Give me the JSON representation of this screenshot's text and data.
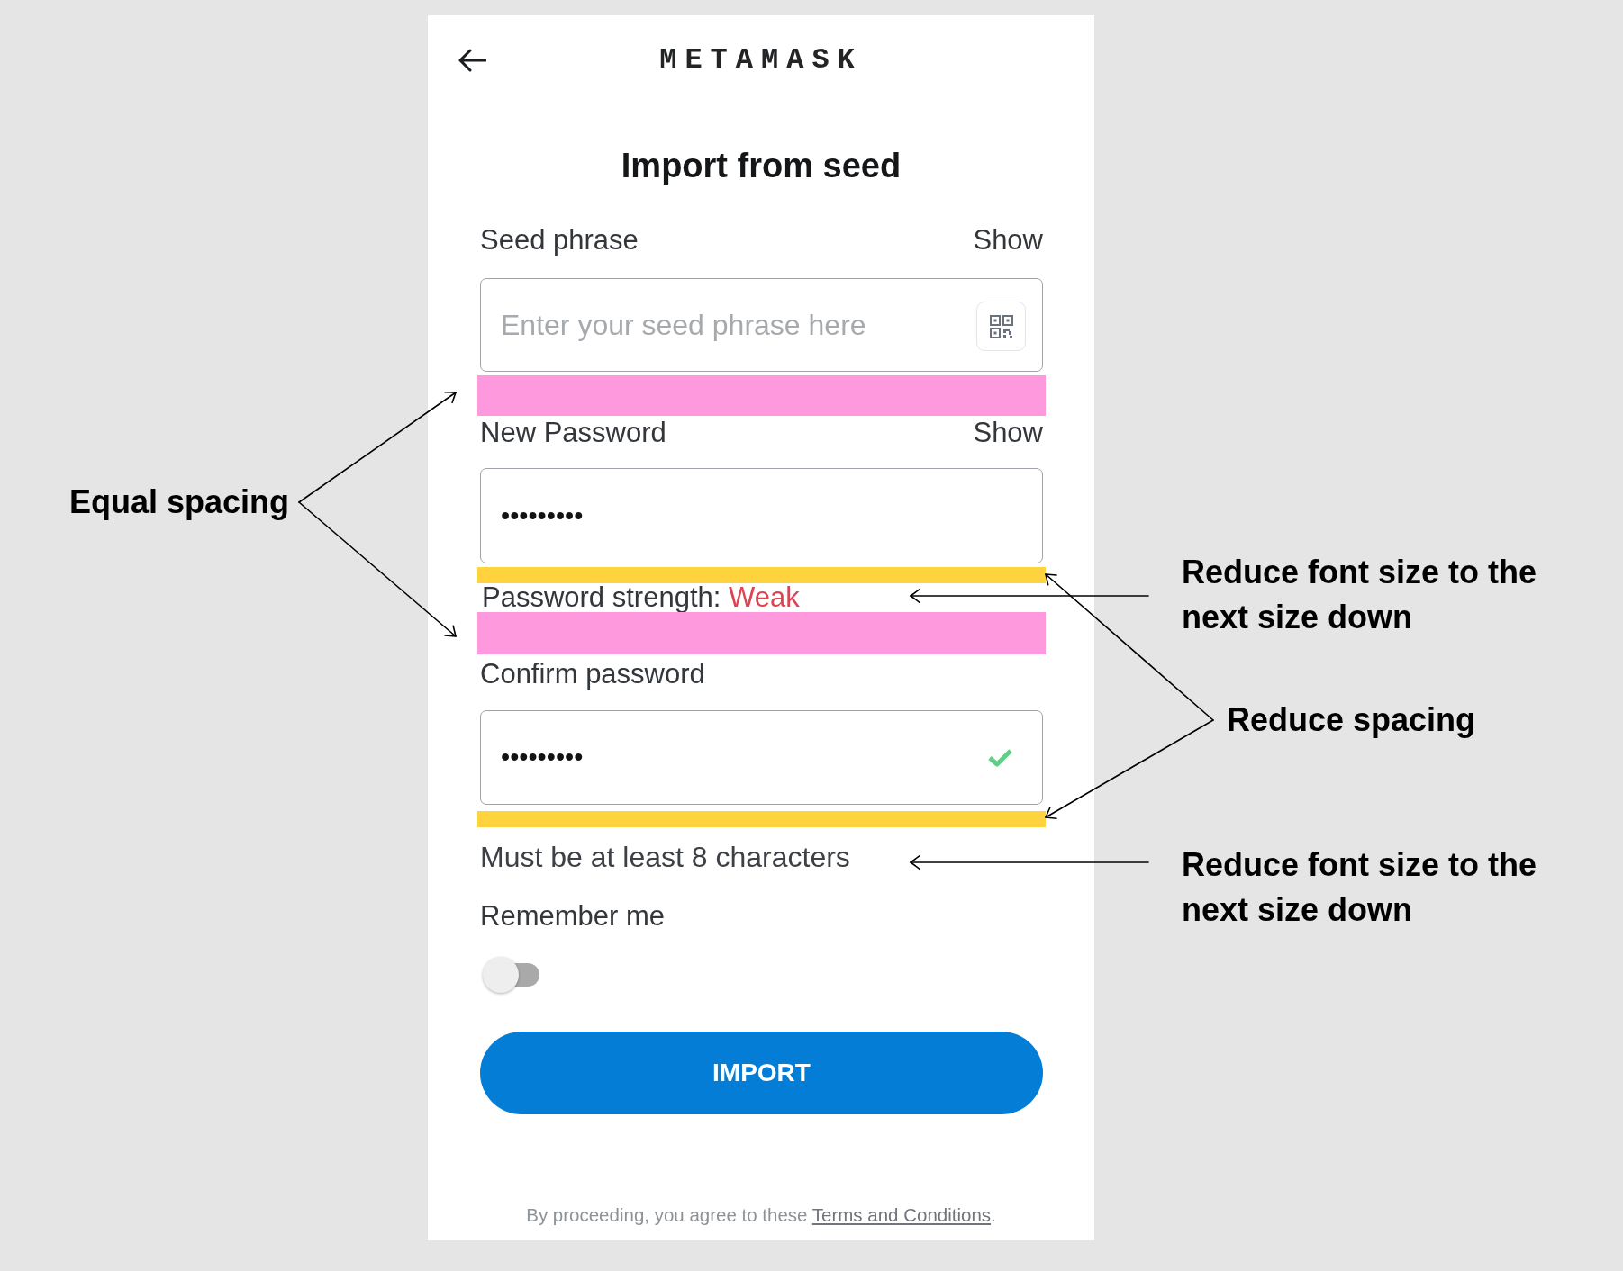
{
  "header": {
    "title": "METAMASK"
  },
  "heading": "Import from seed",
  "form": [
    {
      "kind": "label",
      "text": "Seed phrase",
      "action": "Show"
    },
    {
      "kind": "seed_input",
      "placeholder": "Enter your seed phrase here"
    },
    {
      "kind": "highlight",
      "color": "#ff99dd"
    },
    {
      "kind": "label",
      "text": "New Password",
      "action": "Show"
    },
    {
      "kind": "password_input",
      "value": "•••••••••",
      "matched": false
    },
    {
      "kind": "highlight",
      "color": "#ffd33d"
    },
    {
      "kind": "strength",
      "label": "Password strength:",
      "value": "Weak"
    },
    {
      "kind": "highlight",
      "color": "#ff99dd"
    },
    {
      "kind": "label",
      "text": "Confirm password"
    },
    {
      "kind": "password_input",
      "value": "•••••••••",
      "matched": true
    },
    {
      "kind": "highlight",
      "color": "#ffd33d"
    },
    {
      "kind": "hint",
      "text": "Must be at least 8 characters"
    },
    {
      "kind": "label",
      "text": "Remember me"
    },
    {
      "kind": "toggle",
      "on": false
    },
    {
      "kind": "button",
      "text": "IMPORT"
    }
  ],
  "footer": {
    "text": "By proceeding, you agree to these",
    "link": "Terms and Conditions",
    "after": "."
  },
  "annotations": [
    {
      "text": "Equal spacing"
    },
    {
      "text": "Reduce font size to the next size down"
    },
    {
      "text": "Reduce spacing"
    },
    {
      "text": "Reduce font size to the next size down"
    }
  ]
}
